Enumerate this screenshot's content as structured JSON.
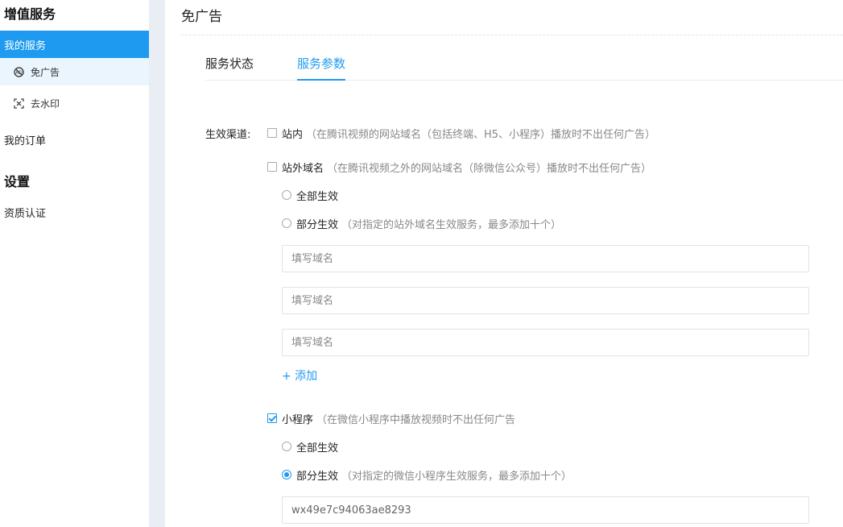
{
  "sidebar": {
    "section1_title": "增值服务",
    "my_services": "我的服务",
    "sub_items": [
      {
        "label": "免广告",
        "icon": "no-ad-icon"
      },
      {
        "label": "去水印",
        "icon": "watermark-icon"
      }
    ],
    "my_orders": "我的订单",
    "section2_title": "设置",
    "qualification": "资质认证"
  },
  "main": {
    "title": "免广告",
    "tabs": [
      {
        "label": "服务状态",
        "active": false
      },
      {
        "label": "服务参数",
        "active": true
      }
    ],
    "channel_label": "生效渠道:",
    "onsite": {
      "label": "站内",
      "hint": "（在腾讯视频的网站域名（包括终端、H5、小程序）播放时不出任何广告）",
      "checked": false
    },
    "offsite": {
      "label": "站外域名",
      "hint": "（在腾讯视频之外的网站域名（除微信公众号）播放时不出任何广告）",
      "checked": false,
      "all_label": "全部生效",
      "partial_label": "部分生效",
      "partial_hint": "（对指定的站外域名生效服务，最多添加十个）",
      "inputs": [
        {
          "placeholder": "填写域名",
          "value": ""
        },
        {
          "placeholder": "填写域名",
          "value": ""
        },
        {
          "placeholder": "填写域名",
          "value": ""
        }
      ],
      "add_label": "+ 添加"
    },
    "miniapp": {
      "label": "小程序",
      "hint": "（在微信小程序中播放视频时不出任何广告",
      "checked": true,
      "all_label": "全部生效",
      "partial_label": "部分生效",
      "partial_hint": "（对指定的微信小程序生效服务，最多添加十个）",
      "selected": "partial",
      "input": {
        "placeholder": "",
        "value": "wx49e7c94063ae8293"
      }
    }
  },
  "colors": {
    "accent": "#1e9bf0",
    "sidebar_strip": "#e9eef5"
  }
}
